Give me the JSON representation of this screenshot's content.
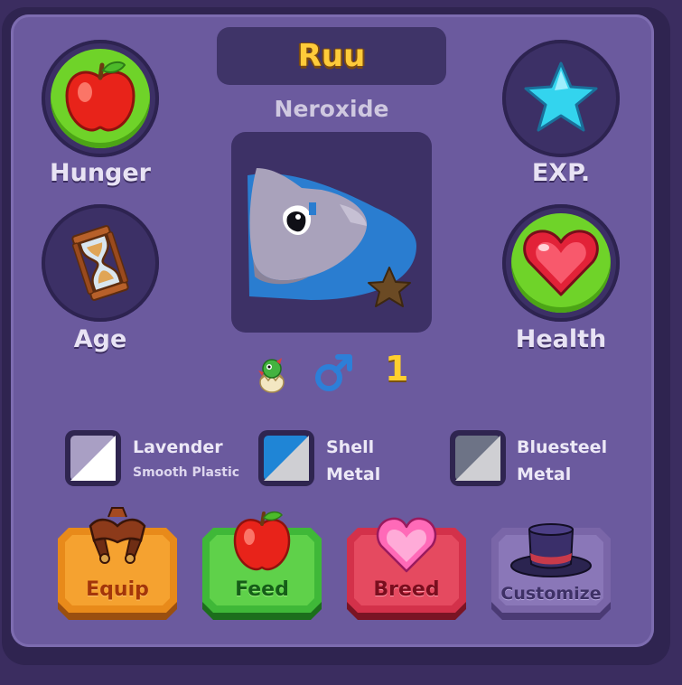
{
  "pet": {
    "name": "Ruu",
    "species": "Neroxide",
    "level": "1",
    "gender_icon": "male-symbol-icon",
    "stage_icon": "hatchling-egg-icon"
  },
  "stats": {
    "hunger": {
      "label": "Hunger",
      "icon": "apple-icon",
      "active": true
    },
    "age": {
      "label": "Age",
      "icon": "hourglass-icon",
      "active": false
    },
    "exp": {
      "label": "EXP.",
      "icon": "star-icon",
      "active": false
    },
    "health": {
      "label": "Health",
      "icon": "heart-icon",
      "active": true
    }
  },
  "materials": [
    {
      "name": "Lavender",
      "type": "Smooth Plastic",
      "colors": [
        "#a99fc4",
        "#ffffff"
      ]
    },
    {
      "name": "Shell",
      "type": "Metal",
      "colors": [
        "#1f85d6",
        "#cfcfd3"
      ]
    },
    {
      "name": "Bluesteel",
      "type": "Metal",
      "colors": [
        "#6d7386",
        "#cfcfd3"
      ]
    }
  ],
  "actions": {
    "equip": {
      "label": "Equip",
      "color": "#e88a1a"
    },
    "feed": {
      "label": "Feed",
      "color": "#3fb838"
    },
    "breed": {
      "label": "Breed",
      "color": "#d3314a"
    },
    "customize": {
      "label": "Customize",
      "color": "#7a66a8"
    }
  },
  "colors": {
    "panel": "#6b5a9e",
    "active_stat": "#6fd329",
    "name": "#ffcb3a"
  }
}
